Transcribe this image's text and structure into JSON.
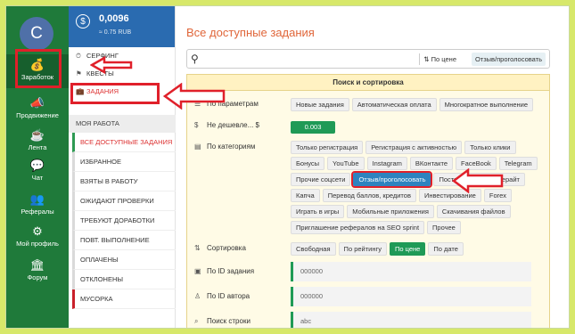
{
  "nav": {
    "avatar_letter": "C",
    "items": [
      {
        "label": "Заработок",
        "icon": "money-bag-icon"
      },
      {
        "label": "Продвижение",
        "icon": "megaphone-icon"
      },
      {
        "label": "Лента",
        "icon": "coffee-icon"
      },
      {
        "label": "Чат",
        "icon": "chat-icon"
      },
      {
        "label": "Рефералы",
        "icon": "users-icon"
      },
      {
        "label": "Мой профиль",
        "icon": "gear-icon"
      },
      {
        "label": "Форум",
        "icon": "forum-icon"
      }
    ]
  },
  "balance": {
    "amount": "0,0096",
    "rub": "≈ 0.75 RUB",
    "icon": "dollar-icon"
  },
  "menu": {
    "top": [
      {
        "label": "СЕРФИНГ",
        "icon": "clock-icon"
      },
      {
        "label": "КВЕСТЫ",
        "icon": "quest-icon"
      },
      {
        "label": "ЗАДАНИЯ",
        "icon": "briefcase-icon"
      }
    ],
    "my_work": "МОЯ РАБОТА",
    "work_items": [
      "ВСЕ ДОСТУПНЫЕ ЗАДАНИЯ",
      "ИЗБРАННОЕ",
      "ВЗЯТЫ В РАБОТУ",
      "ОЖИДАЮТ ПРОВЕРКИ",
      "ТРЕБУЮТ ДОРАБОТКИ",
      "ПОВТ. ВЫПОЛНЕНИЕ",
      "ОПЛАЧЕНЫ",
      "ОТКЛОНЕНЫ",
      "МУСОРКА"
    ]
  },
  "main": {
    "title": "Все доступные задания",
    "search": {
      "sort_price": "По цене",
      "sort_review": "Отзыв/проголосовать"
    },
    "panel_title": "Поиск и сортировка",
    "params_label": "По параметрам",
    "params_tags": [
      "Новые задания",
      "Автоматическая оплата",
      "Многократное выполнение"
    ],
    "price_label": "Не дешевле... $",
    "price_value": "0.003",
    "category_label": "По категориям",
    "category_tags": [
      "Только регистрация",
      "Регистрация с активностью",
      "Только клики",
      "Бонусы",
      "YouTube",
      "Instagram",
      "ВКонтакте",
      "FaceBook",
      "Telegram",
      "Прочие соцсети",
      "Отзыв/проголосовать",
      "Постинг, копирайт, рерайт",
      "Капча",
      "Перевод баллов, кредитов",
      "Инвестирование",
      "Forex",
      "Играть в игры",
      "Мобильные приложения",
      "Скачивания файлов",
      "Приглашение рефералов на SEO sprint",
      "Прочее"
    ],
    "sort_label": "Сортировка",
    "sort_tags": [
      "Свободная",
      "По рейтингу",
      "По цене",
      "По дате"
    ],
    "task_id_label": "По ID задания",
    "task_id_value": "000000",
    "author_id_label": "По ID автора",
    "author_id_value": "000000",
    "search_str_label": "Поиск строки",
    "search_str_value": "abc"
  },
  "colors": {
    "nav": "#1f7a3a",
    "balance": "#2a6bb0",
    "accent_green": "#1f9a56",
    "highlight_red": "#e0202a",
    "title": "#e0663a"
  }
}
